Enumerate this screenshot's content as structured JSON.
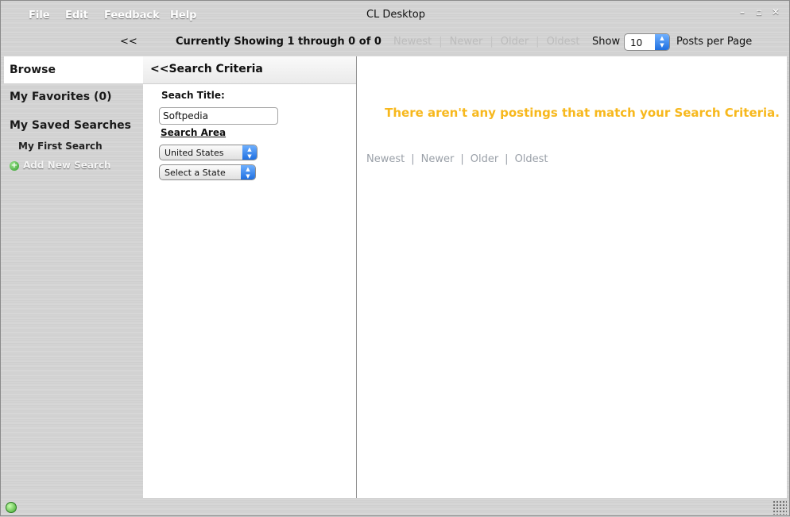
{
  "window": {
    "title": "CL Desktop",
    "minimize": "–",
    "maximize": "▫",
    "close": "✕"
  },
  "menu": {
    "file": "File",
    "edit": "Edit",
    "feedback": "Feedback",
    "help": "Help"
  },
  "toolbar": {
    "collapse": "<<",
    "showing": "Currently Showing 1 through 0 of  0",
    "pager": {
      "newest": "Newest",
      "newer": "Newer",
      "older": "Older",
      "oldest": "Oldest",
      "sep": "|"
    },
    "show_label": "Show",
    "posts_per_page": "10",
    "posts_label": "Posts per Page"
  },
  "sidebar": {
    "browse": "Browse",
    "favorites": "My Favorites (0)",
    "saved_searches": "My Saved Searches",
    "first_search": "My First Search",
    "add_new": "Add New Search"
  },
  "criteria": {
    "header": "<<Search Criteria",
    "title_label": "Seach Title:",
    "title_value": "Softpedia",
    "area_label": "Search Area",
    "country": "United States",
    "state": "Select a State"
  },
  "results": {
    "message": "There aren't any postings that match your Search Criteria.",
    "pager": {
      "newest": "Newest",
      "newer": "Newer",
      "older": "Older",
      "oldest": "Oldest",
      "sep": "|"
    }
  },
  "colors": {
    "message": "#f7b81d",
    "accent_blue": "#1f6fe0",
    "status_green": "#3ca52b"
  }
}
